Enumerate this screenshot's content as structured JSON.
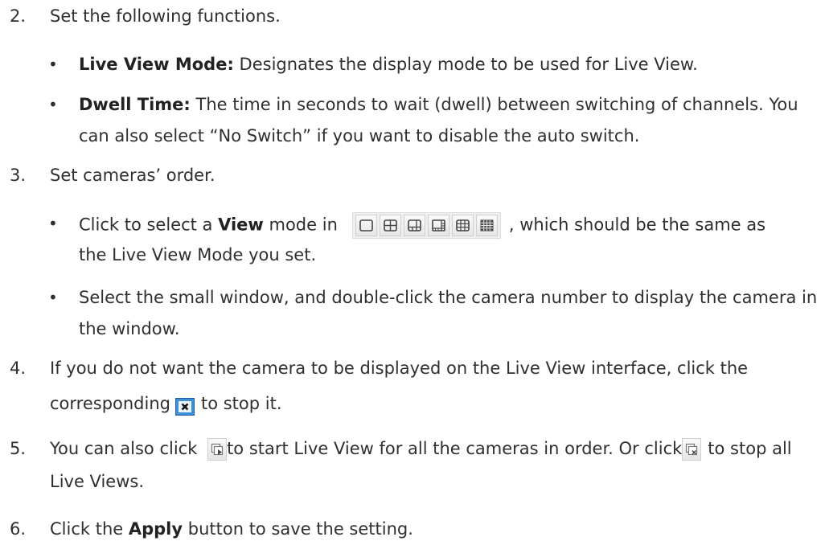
{
  "steps": {
    "s2": {
      "num": "2.",
      "text": "Set the following functions."
    },
    "s2b1": {
      "label": "Live View Mode:",
      "text": " Designates the display mode to be used for Live View."
    },
    "s2b2": {
      "label": "Dwell Time:",
      "text": " The time in seconds to wait (dwell) between switching of channels. You",
      "line2": "can also select “No Switch” if you want to disable the auto switch."
    },
    "s3": {
      "num": "3.",
      "text": "Set cameras’ order."
    },
    "s3b1": {
      "pre": "Click to select a ",
      "bold": "View",
      "mid": " mode in",
      "post": ", which should be the same as",
      "line2": "the Live View Mode you set."
    },
    "s3b2": {
      "text": "Select the small window, and double-click the camera number to display the camera in",
      "line2": "the window."
    },
    "s4": {
      "num": "4.",
      "text": "If you do not want the camera to be displayed on the Live View interface, click the",
      "line2_pre": "corresponding",
      "line2_post": "to stop it."
    },
    "s5": {
      "num": "5.",
      "pre": "You can also click",
      "mid": "to start Live View for all the cameras in order. Or click",
      "post": "to stop all",
      "line2": "Live Views."
    },
    "s6": {
      "num": "6.",
      "pre": "Click the ",
      "bold": "Apply",
      "post": " button to save the setting."
    }
  },
  "bullet": "•",
  "icons": {
    "layout_modes": [
      "1-window-layout-icon",
      "4-window-layout-icon",
      "6-window-layout-icon",
      "8-window-layout-icon",
      "9-window-layout-icon",
      "16-window-layout-icon"
    ],
    "stop": "stop-live-view-icon",
    "start_all": "start-all-live-view-icon",
    "stop_all": "stop-all-live-view-icon"
  },
  "colors": {
    "text": "#2f2f2f",
    "stop_icon_blue": "#3d8fd6"
  }
}
